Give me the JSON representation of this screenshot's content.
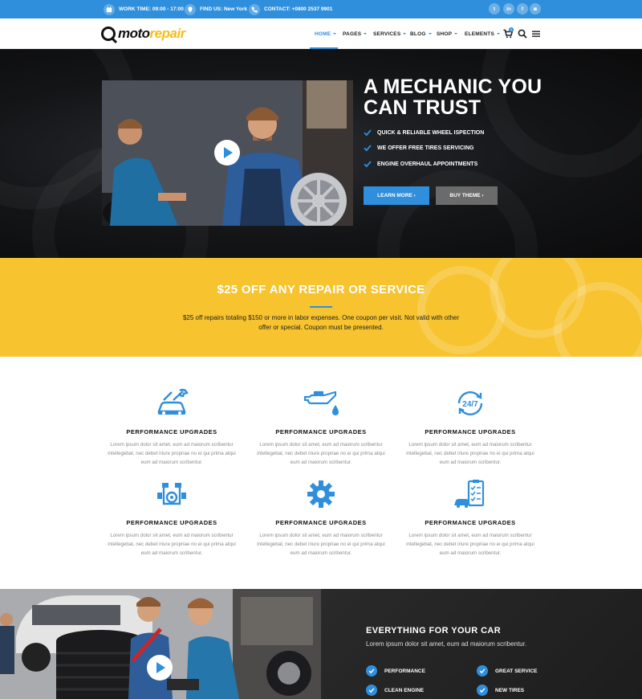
{
  "topbar": {
    "work_time": "WORK TIME: 09:00 - 17:00",
    "find_us": "FIND US: New York",
    "contact": "CONTACT: +0800 2537 9901",
    "social": [
      "t",
      "in",
      "f",
      "◙"
    ]
  },
  "logo": {
    "part1": "moto",
    "part2": "repair"
  },
  "nav": {
    "items": [
      "HOME",
      "PAGES",
      "SERVICES",
      "BLOG",
      "SHOP",
      "ELEMENTS"
    ],
    "cart_count": "0"
  },
  "hero": {
    "title_line1": "A MECHANIC YOU",
    "title_line2": "CAN TRUST",
    "checks": [
      "QUICK & RELIABLE WHEEL ISPECTION",
      "WE OFFER FREE TIRES SERVICING",
      "ENGINE OVERHAUL APPOINTMENTS"
    ],
    "learn_more": "LEARN MORE",
    "buy_theme": "BUY THEME"
  },
  "promo": {
    "title": "$25 OFF ANY REPAIR OR SERVICE",
    "text": "$25 off repairs totaling $150 or more in labor expenses. One coupon per visit. Not valid with other offer or special. Coupon must be presented."
  },
  "features": [
    {
      "icon": "car-wrench-icon",
      "title": "PERFORMANCE UPGRADES",
      "text": "Lorem ipsum dolor sit amet, eum ad maiorum scribentur intellegebat, nec debet iriure propriae no ei qui prima atqui eum ad maiorum scribentur."
    },
    {
      "icon": "oil-can-icon",
      "title": "PERFORMANCE UPGRADES",
      "text": "Lorem ipsum dolor sit amet, eum ad maiorum scribentur intellegebat, nec debet iriure propriae no ei qui prima atqui eum ad maiorum scribentur."
    },
    {
      "icon": "24-7-icon",
      "title": "PERFORMANCE UPGRADES",
      "text": "Lorem ipsum dolor sit amet, eum ad maiorum scribentur intellegebat, nec debet iriure propriae no ei qui prima atqui eum ad maiorum scribentur."
    },
    {
      "icon": "engine-icon",
      "title": "PERFORMANCE UPGRADES",
      "text": "Lorem ipsum dolor sit amet, eum ad maiorum scribentur intellegebat, nec debet iriure propriae no ei qui prima atqui eum ad maiorum scribentur."
    },
    {
      "icon": "gear-icon",
      "title": "PERFORMANCE UPGRADES",
      "text": "Lorem ipsum dolor sit amet, eum ad maiorum scribentur intellegebat, nec debet iriure propriae no ei qui prima atqui eum ad maiorum scribentur."
    },
    {
      "icon": "checklist-car-icon",
      "title": "PERFORMANCE UPGRADES",
      "text": "Lorem ipsum dolor sit amet, eum ad maiorum scribentur intellegebat, nec debet iriure propriae no ei qui prima atqui eum ad maiorum scribentur."
    }
  ],
  "everything": {
    "title": "EVERYTHING FOR YOUR CAR",
    "subtitle": "Lorem ipsum dolor sit amet, eum ad maiorum scribentur.",
    "items": [
      "PERFORMANCE",
      "GREAT SERVICE",
      "CLEAN ENGINE",
      "NEW TIRES"
    ]
  },
  "colors": {
    "accent": "#2f8fdc",
    "yellow": "#f7c32e",
    "dark": "#141517"
  }
}
